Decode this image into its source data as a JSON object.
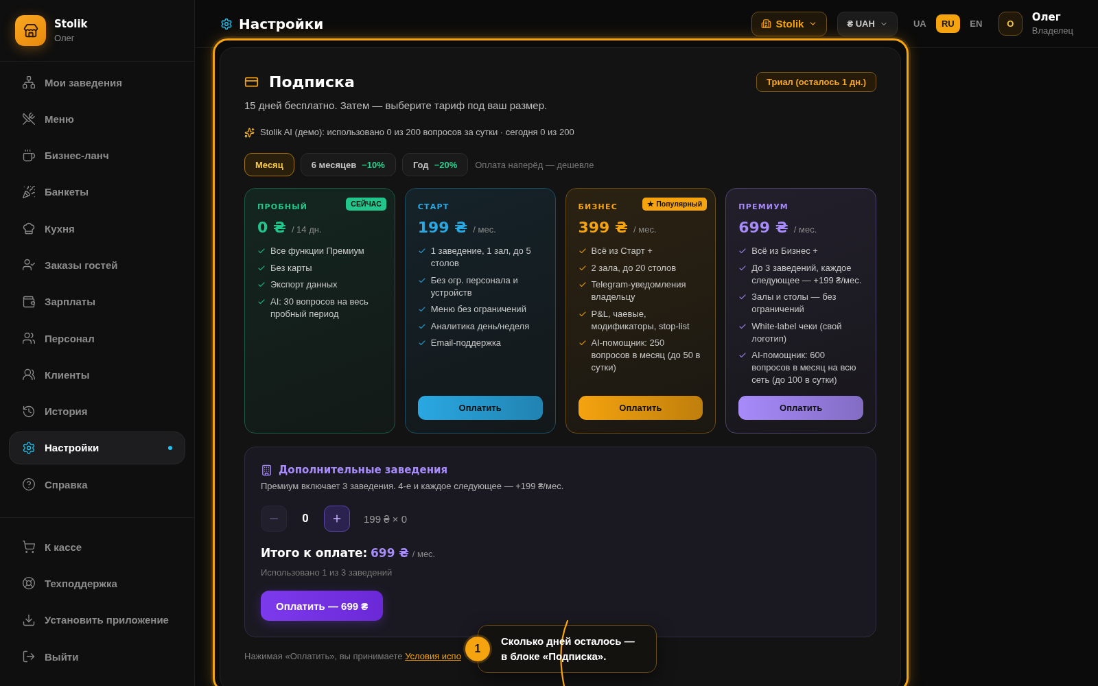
{
  "sidebar": {
    "brand": {
      "name": "Stolik",
      "user": "Олег"
    },
    "nav": [
      {
        "label": "Мои заведения",
        "selected": false
      },
      {
        "label": "Меню",
        "selected": false
      },
      {
        "label": "Бизнес-ланч",
        "selected": false
      },
      {
        "label": "Банкеты",
        "selected": false
      },
      {
        "label": "Кухня",
        "selected": false
      },
      {
        "label": "Заказы гостей",
        "selected": false
      },
      {
        "label": "Зарплаты",
        "selected": false
      },
      {
        "label": "Персонал",
        "selected": false
      },
      {
        "label": "Клиенты",
        "selected": false
      },
      {
        "label": "История",
        "selected": false
      },
      {
        "label": "Настройки",
        "selected": true
      },
      {
        "label": "Справка",
        "selected": false
      }
    ],
    "footer_nav": [
      {
        "label": "К кассе"
      },
      {
        "label": "Техподдержка"
      },
      {
        "label": "Установить приложение"
      },
      {
        "label": "Выйти"
      }
    ]
  },
  "header": {
    "title": "Настройки",
    "venue_select": {
      "label": "Stolik"
    },
    "currency_select": {
      "label": "₴ UAH"
    },
    "languages": [
      {
        "label": "UA",
        "selected": false
      },
      {
        "label": "RU",
        "selected": true
      },
      {
        "label": "EN",
        "selected": false
      }
    ],
    "user": {
      "initial": "О",
      "name": "Олег",
      "role": "Владелец"
    }
  },
  "subscription": {
    "title": "Подписка",
    "status_badge": "Триал (осталось 1 дн.)",
    "subtitle": "15 дней бесплатно. Затем — выберите тариф под ваш размер.",
    "ai_usage": "Stolik AI (демо): использовано 0 из 200 вопросов за сутки · сегодня 0 из 200",
    "periods": [
      {
        "label": "Месяц",
        "selected": true
      },
      {
        "label": "6 месяцев",
        "discount": "−10%",
        "selected": false
      },
      {
        "label": "Год",
        "discount": "−20%",
        "selected": false
      }
    ],
    "period_note": "Оплата наперёд — дешевле",
    "plans": [
      {
        "name": "ПРОБНЫЙ",
        "badge": "СЕЙЧАС",
        "price": "0 ₴",
        "period": "/ 14 дн.",
        "color": "#22c58b",
        "features": [
          "Все функции Премиум",
          "Без карты",
          "Экспорт данных",
          "AI: 30 вопросов на весь пробный период"
        ]
      },
      {
        "name": "СТАРТ",
        "price": "199 ₴",
        "period": "/ мес.",
        "color": "#2aa8e2",
        "features": [
          "1 заведение, 1 зал, до 5 столов",
          "Без огр. персонала и устройств",
          "Меню без ограничений",
          "Аналитика день/неделя",
          "Email-поддержка"
        ],
        "button": "Оплатить"
      },
      {
        "name": "БИЗНЕС",
        "badge": "★ Популярный",
        "price": "399 ₴",
        "period": "/ мес.",
        "color": "#f5a30f",
        "features": [
          "Всё из Старт +",
          "2 зала, до 20 столов",
          "Telegram-уведомления владельцу",
          "P&L, чаевые, модификаторы, stop-list",
          "AI-помощник: 250 вопросов в месяц (до 50 в сутки)"
        ],
        "button": "Оплатить"
      },
      {
        "name": "ПРЕМИУМ",
        "price": "699 ₴",
        "period": "/ мес.",
        "color": "#a78bfa",
        "features": [
          "Всё из Бизнес +",
          "До 3 заведений, каждое следующее — +199 ₴/мес.",
          "Залы и столы — без ограничений",
          "White-label чеки (свой логотип)",
          "AI-помощник: 600 вопросов в месяц на всю сеть (до 100 в сутки)"
        ],
        "button": "Оплатить"
      }
    ],
    "extra_venues": {
      "title": "Дополнительные заведения",
      "description": "Премиум включает 3 заведения. 4-е и каждое следующее — +199 ₴/мес.",
      "decrement": {
        "disabled": true
      },
      "quantity": "0",
      "increment": {
        "disabled": false
      },
      "calculation": "199 ₴ × 0",
      "total_label": "Итого к оплате:",
      "total_amount": "699 ₴",
      "total_period": "/ мес.",
      "usage": "Использовано 1 из 3 заведений",
      "pay_button": "Оплатить — 699 ₴"
    },
    "terms": {
      "text": "Нажимая «Оплатить», вы принимаете",
      "link": "Условия испо"
    }
  },
  "tour_tip": {
    "step": "1",
    "text": "Сколько дней осталось — в блоке «Подписка»."
  }
}
